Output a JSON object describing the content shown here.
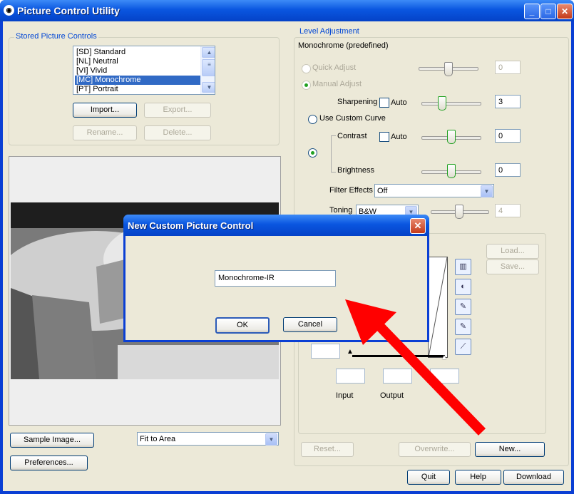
{
  "window": {
    "title": "Picture Control Utility",
    "minimize_icon": "minimize-icon",
    "maximize_icon": "maximize-icon",
    "close_icon": "close-icon"
  },
  "stored": {
    "group_label": "Stored Picture Controls",
    "items": [
      "[SD] Standard",
      "[NL] Neutral",
      "[VI] Vivid",
      "[MC] Monochrome",
      "[PT] Portrait"
    ],
    "selected_index": 3,
    "import_label": "Import...",
    "export_label": "Export...",
    "rename_label": "Rename...",
    "delete_label": "Delete..."
  },
  "bottom_left": {
    "sample_image_label": "Sample Image...",
    "fit_value": "Fit to Area",
    "preferences_label": "Preferences..."
  },
  "level": {
    "group_label": "Level Adjustment",
    "subtitle": "Monochrome (predefined)",
    "quick_adjust_label": "Quick Adjust",
    "quick_adjust_value": "0",
    "manual_adjust_label": "Manual Adjust",
    "sharpening_label": "Sharpening",
    "sharpening_auto": "Auto",
    "sharpening_value": "3",
    "custom_curve_label": "Use Custom Curve",
    "contrast_label": "Contrast",
    "contrast_auto": "Auto",
    "contrast_value": "0",
    "brightness_label": "Brightness",
    "brightness_value": "0",
    "filter_label": "Filter Effects",
    "filter_value": "Off",
    "toning_label": "Toning",
    "toning_value": "B&W",
    "toning_level_value": "4"
  },
  "curve": {
    "load_label": "Load...",
    "save_label": "Save...",
    "input_label": "Input",
    "output_label": "Output",
    "icons": [
      "histogram-icon",
      "contrast-icon",
      "eyedropper-icon",
      "eyedropper-icon",
      "curve-icon"
    ]
  },
  "footer": {
    "reset_label": "Reset...",
    "overwrite_label": "Overwrite...",
    "new_label": "New...",
    "quit_label": "Quit",
    "help_label": "Help",
    "download_label": "Download"
  },
  "dialog": {
    "title": "New Custom Picture Control",
    "name_value": "Monochrome-IR",
    "ok_label": "OK",
    "cancel_label": "Cancel"
  },
  "colors": {
    "accent": "#0046d5",
    "arrow": "#ff0000"
  }
}
